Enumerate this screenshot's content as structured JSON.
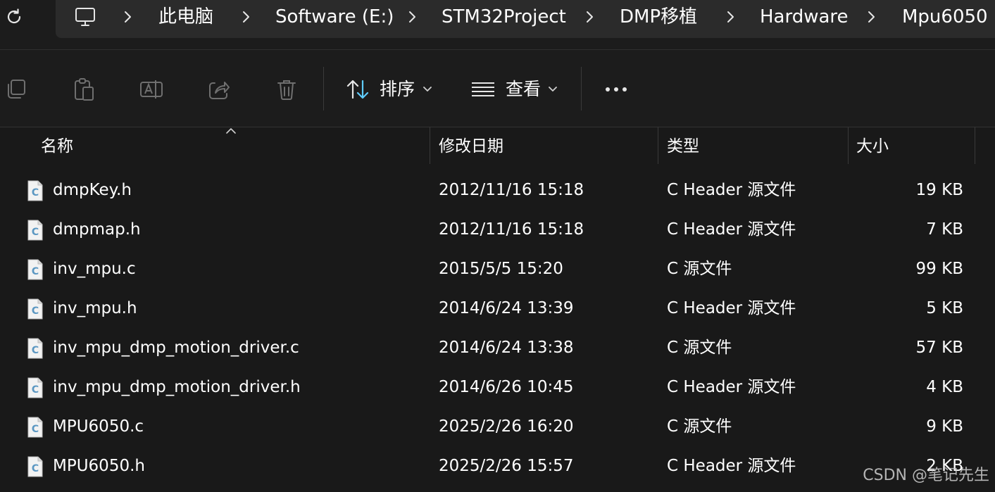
{
  "breadcrumb": [
    "此电脑",
    "Software (E:)",
    "STM32Project",
    "DMP移植",
    "Hardware",
    "Mpu6050"
  ],
  "toolbar": {
    "sort_label": "排序",
    "view_label": "查看"
  },
  "columns": {
    "name": "名称",
    "date": "修改日期",
    "type": "类型",
    "size": "大小"
  },
  "files": [
    {
      "name": "dmpKey.h",
      "date": "2012/11/16 15:18",
      "type": "C Header 源文件",
      "size": "19 KB"
    },
    {
      "name": "dmpmap.h",
      "date": "2012/11/16 15:18",
      "type": "C Header 源文件",
      "size": "7 KB"
    },
    {
      "name": "inv_mpu.c",
      "date": "2015/5/5 15:20",
      "type": "C 源文件",
      "size": "99 KB"
    },
    {
      "name": "inv_mpu.h",
      "date": "2014/6/24 13:39",
      "type": "C Header 源文件",
      "size": "5 KB"
    },
    {
      "name": "inv_mpu_dmp_motion_driver.c",
      "date": "2014/6/24 13:38",
      "type": "C 源文件",
      "size": "57 KB"
    },
    {
      "name": "inv_mpu_dmp_motion_driver.h",
      "date": "2014/6/26 10:45",
      "type": "C Header 源文件",
      "size": "4 KB"
    },
    {
      "name": "MPU6050.c",
      "date": "2025/2/26 16:20",
      "type": "C 源文件",
      "size": "9 KB"
    },
    {
      "name": "MPU6050.h",
      "date": "2025/2/26 15:57",
      "type": "C Header 源文件",
      "size": "2 KB"
    }
  ],
  "icons": {
    "refresh": "refresh-icon",
    "computer": "computer-icon",
    "chevron": "chevron-right-icon",
    "copy": "copy-icon",
    "paste": "paste-icon",
    "rename": "rename-icon",
    "share": "share-icon",
    "delete": "delete-icon",
    "sort": "sort-icon",
    "view": "view-icon",
    "more": "more-icon",
    "file": "c-file-icon"
  },
  "watermark": "CSDN @笔记先生",
  "colors": {
    "background": "#191919",
    "address_box": "#2b2b2b",
    "file_icon": "#5b97c2",
    "toolbar_icon_disabled": "#6f6f6f"
  }
}
